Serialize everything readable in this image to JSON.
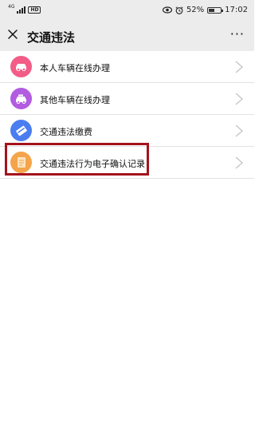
{
  "status_bar": {
    "network": "4G",
    "hd": "HD",
    "battery_percent": "52%",
    "battery_level": 0.52,
    "time": "17:02"
  },
  "nav": {
    "title": "交通违法",
    "more": "···"
  },
  "items": [
    {
      "label": "本人车辆在线办理",
      "icon": "car-icon",
      "color": "#f25c86"
    },
    {
      "label": "其他车辆在线办理",
      "icon": "car-icon",
      "color": "#b25ce0"
    },
    {
      "label": "交通违法缴费",
      "icon": "payment-card-icon",
      "color": "#4a7df0"
    },
    {
      "label": "交通违法行为电子确认记录",
      "icon": "document-icon",
      "color": "#f4a44a"
    }
  ],
  "colors": {
    "highlight": "#a4131d",
    "bar_bg": "#ececec"
  }
}
